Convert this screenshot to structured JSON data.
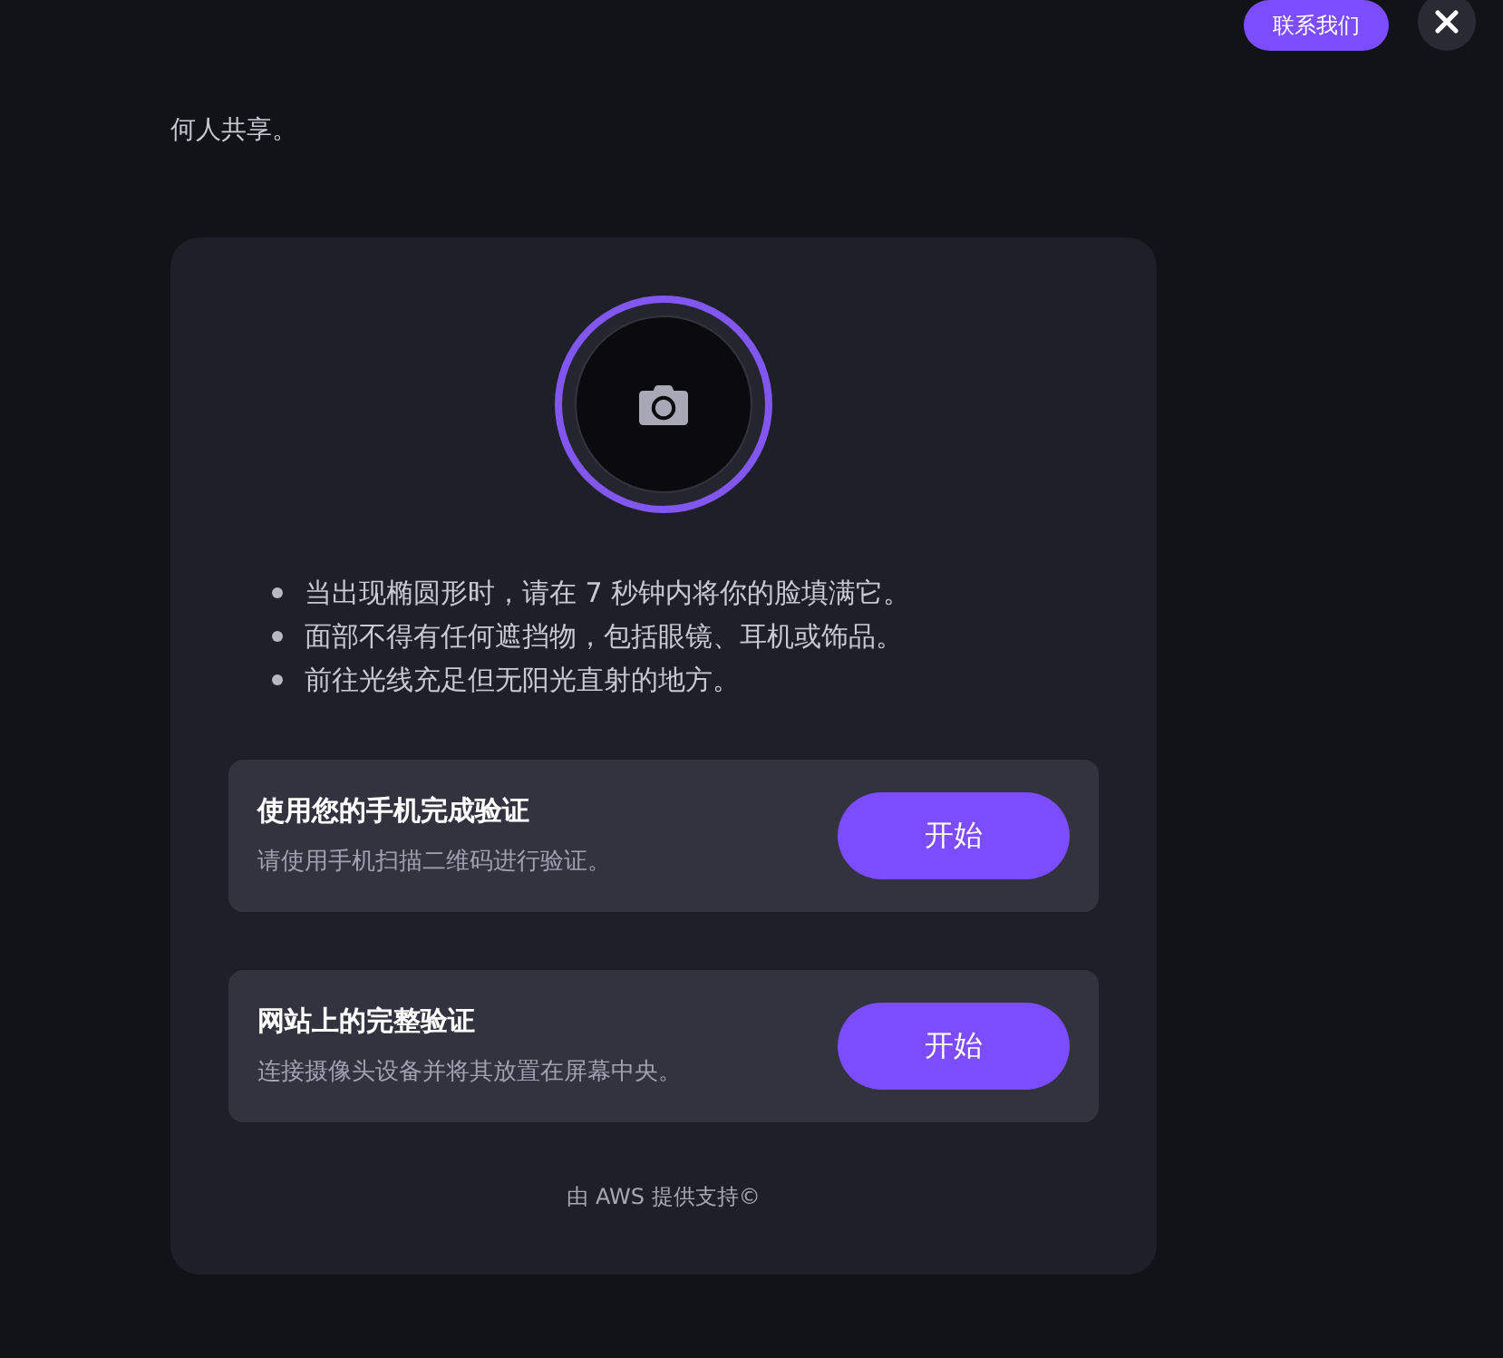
{
  "header": {
    "contact_button": "联系我们"
  },
  "intro_text": "何人共享。",
  "card": {
    "instructions": [
      "当出现椭圆形时，请在 7 秒钟内将你的脸填满它。",
      "面部不得有任何遮挡物，包括眼镜、耳机或饰品。",
      "前往光线充足但无阳光直射的地方。"
    ],
    "options": [
      {
        "title": "使用您的手机完成验证",
        "description": "请使用手机扫描二维码进行验证。",
        "button": "开始"
      },
      {
        "title": "网站上的完整验证",
        "description": "连接摄像头设备并将其放置在屏幕中央。",
        "button": "开始"
      }
    ],
    "footer": "由 AWS 提供支持©"
  }
}
